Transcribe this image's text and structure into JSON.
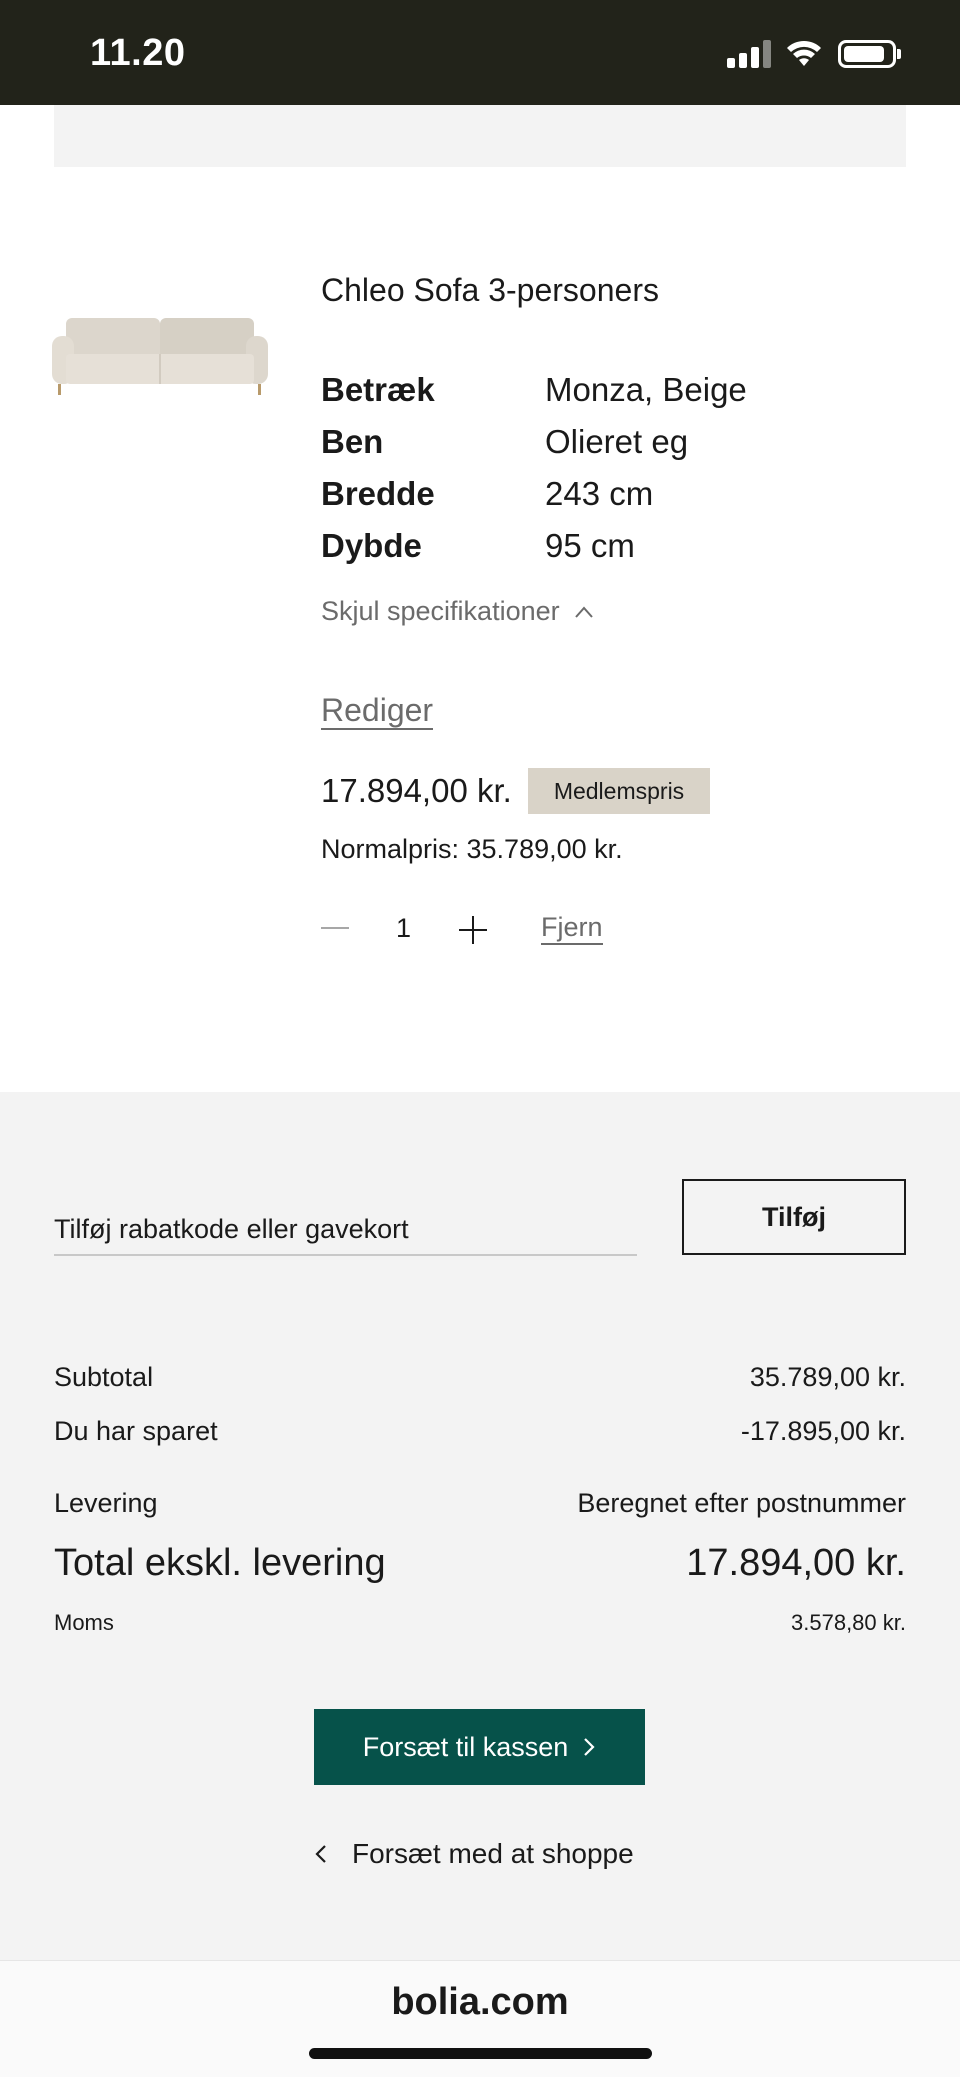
{
  "status_bar": {
    "time": "11.20"
  },
  "product": {
    "name": "Chleo Sofa 3-personers",
    "image_icon": "sofa-image",
    "specs": [
      {
        "key": "Betræk",
        "value": "Monza, Beige"
      },
      {
        "key": "Ben",
        "value": "Olieret eg"
      },
      {
        "key": "Bredde",
        "value": "243 cm"
      },
      {
        "key": "Dybde",
        "value": "95 cm"
      }
    ],
    "toggle_specs_label": "Skjul specifikationer",
    "edit_label": "Rediger",
    "price": "17.894,00 kr.",
    "badge": "Medlemspris",
    "normal_price": "Normalpris: 35.789,00 kr.",
    "quantity": "1",
    "remove_label": "Fjern"
  },
  "summary": {
    "discount_placeholder": "Tilføj rabatkode eller gavekort",
    "add_button": "Tilføj",
    "subtotal_label": "Subtotal",
    "subtotal_value": "35.789,00 kr.",
    "saved_label": "Du har sparet",
    "saved_value": "-17.895,00 kr.",
    "delivery_label": "Levering",
    "delivery_value": "Beregnet efter postnummer",
    "total_label": "Total ekskl. levering",
    "total_value": "17.894,00 kr.",
    "vat_label": "Moms",
    "vat_value": "3.578,80 kr.",
    "checkout_button": "Forsæt til kassen",
    "continue_shopping": "Forsæt med at shoppe"
  },
  "browser": {
    "url": "bolia.com"
  },
  "colors": {
    "checkout": "#06524a",
    "badge": "#d9d3c8",
    "statusbar": "#22231a"
  }
}
